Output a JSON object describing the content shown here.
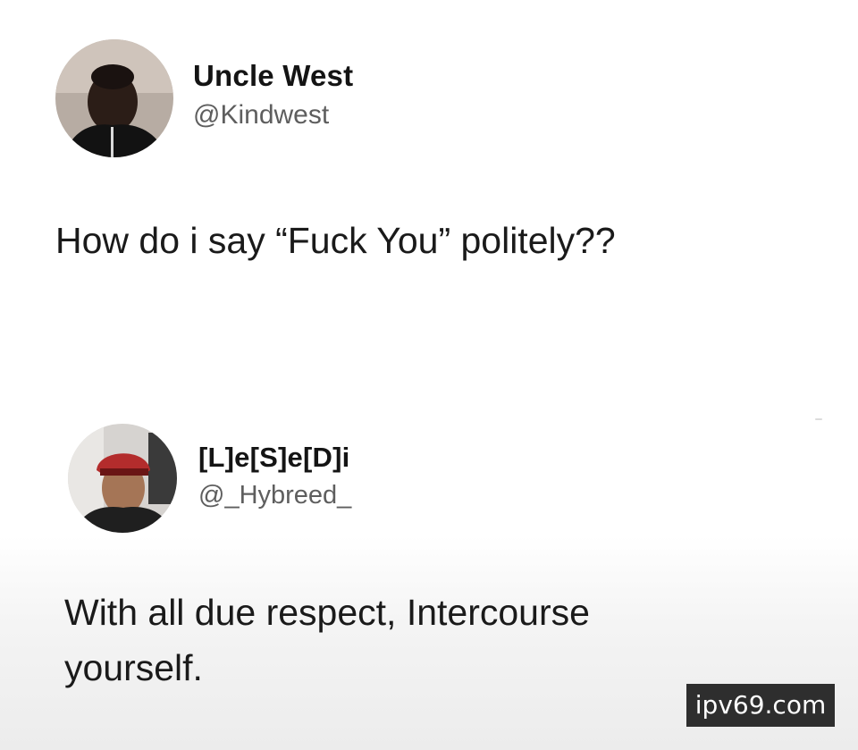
{
  "tweet_1": {
    "display_name": "Uncle West",
    "handle": "@Kindwest",
    "text": "How do i say “Fuck You” politely??"
  },
  "tweet_2": {
    "display_name": "[L]e[S]e[D]i",
    "handle": "@_Hybreed_",
    "text": "With all due respect, Intercourse yourself."
  },
  "watermark": {
    "text": "ipv69.com"
  }
}
